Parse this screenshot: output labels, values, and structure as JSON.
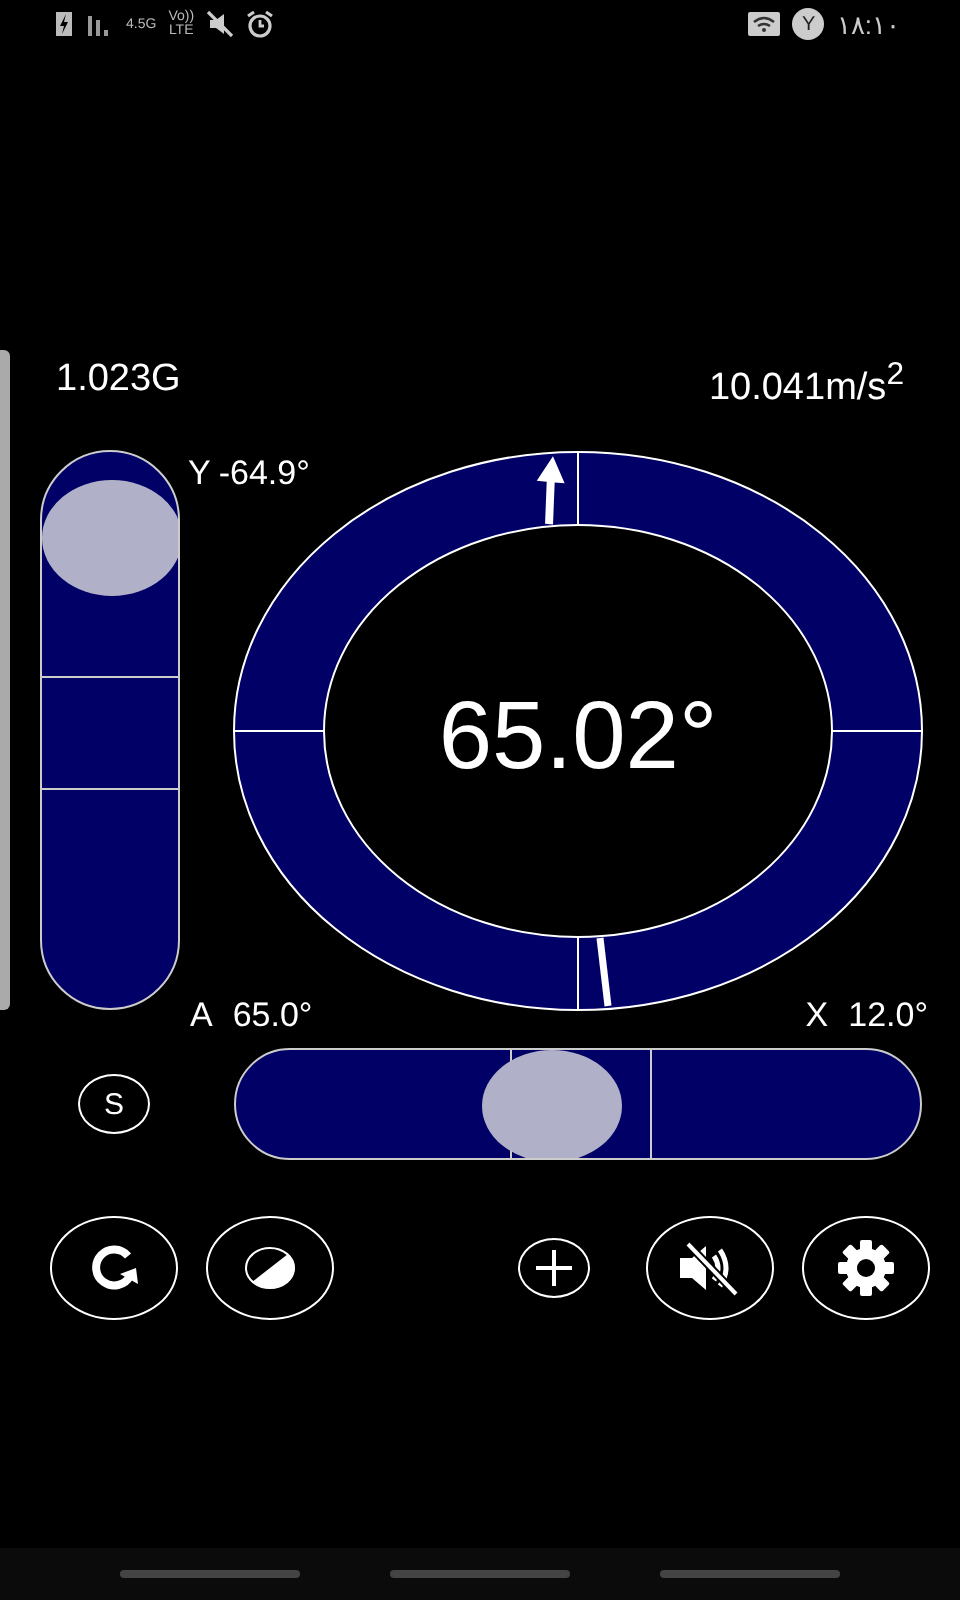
{
  "status_bar": {
    "network": [
      "4.5G",
      "Vo))",
      "LTE"
    ],
    "profile": "Y",
    "time": "١٨:١٠"
  },
  "readings": {
    "gravity": "1.023G",
    "acceleration": "10.041m/s$^{2}$"
  },
  "vertical_level": {
    "axis": "Y",
    "value": "-64.9°",
    "level": 0.94
  },
  "dial": {
    "reading": "65.02°"
  },
  "angle": {
    "axis": "A",
    "value": "65.0°"
  },
  "horizontal_level": {
    "axis": "X",
    "value": "12.0°",
    "level": 0.45
  },
  "sensor_button": "S",
  "toolbar": [
    {
      "kind": "rotate"
    },
    {
      "kind": "contrast"
    },
    {
      "kind": "add"
    },
    {
      "kind": "mute"
    },
    {
      "kind": "settings"
    }
  ]
}
